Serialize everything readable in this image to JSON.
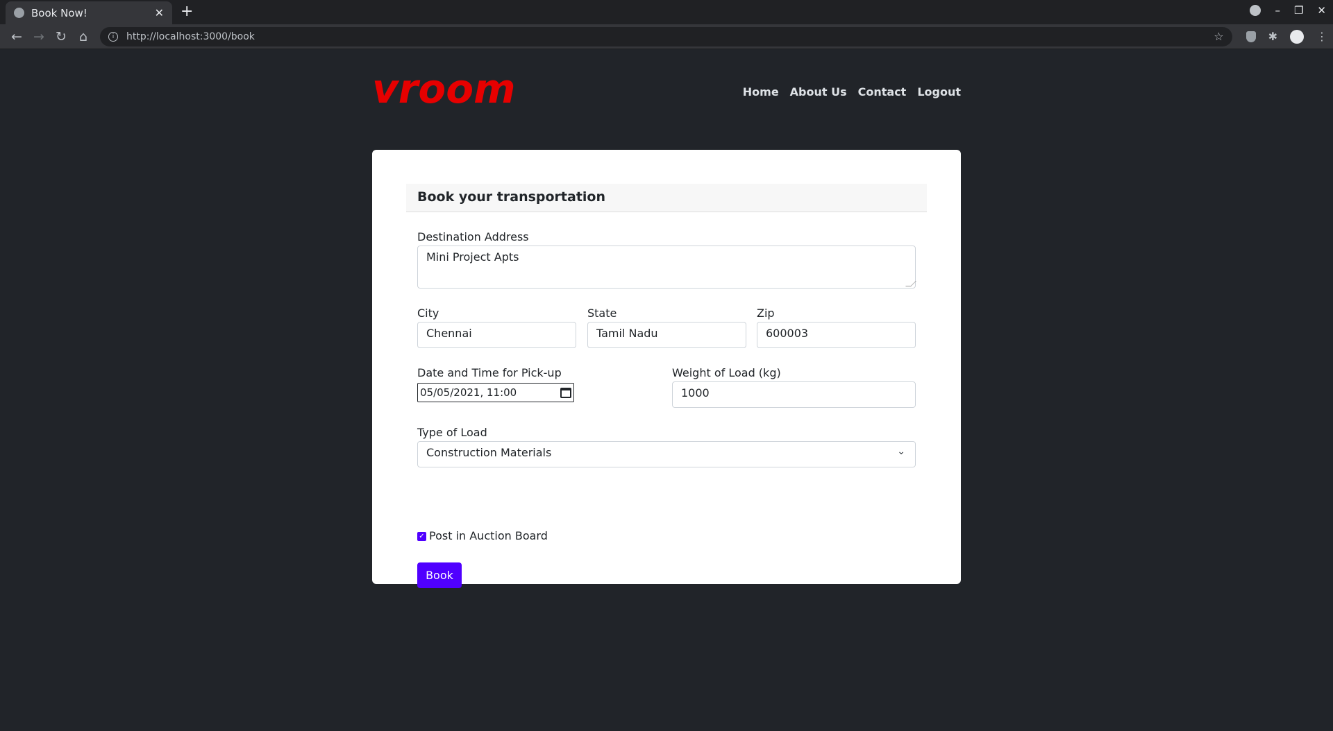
{
  "browser": {
    "tab_title": "Book Now!",
    "url": "http://localhost:3000/book"
  },
  "brand": {
    "logo_text": "vroom",
    "logo_color": "#e60000"
  },
  "nav": {
    "home": "Home",
    "about": "About Us",
    "contact": "Contact",
    "logout": "Logout"
  },
  "form": {
    "title": "Book your transportation",
    "destination_label": "Destination Address",
    "destination_value": "Mini Project Apts",
    "city_label": "City",
    "city_value": "Chennai",
    "state_label": "State",
    "state_value": "Tamil Nadu",
    "zip_label": "Zip",
    "zip_value": "600003",
    "datetime_label": "Date and Time for Pick-up",
    "datetime_value": "05/05/2021, 11:00",
    "weight_label": "Weight of Load (kg)",
    "weight_value": "1000",
    "load_type_label": "Type of Load",
    "load_type_value": "Construction Materials",
    "auction_label": "Post in Auction Board",
    "auction_checked": true,
    "submit_label": "Book"
  },
  "colors": {
    "accent": "#5000ff",
    "page_bg": "#212429"
  }
}
